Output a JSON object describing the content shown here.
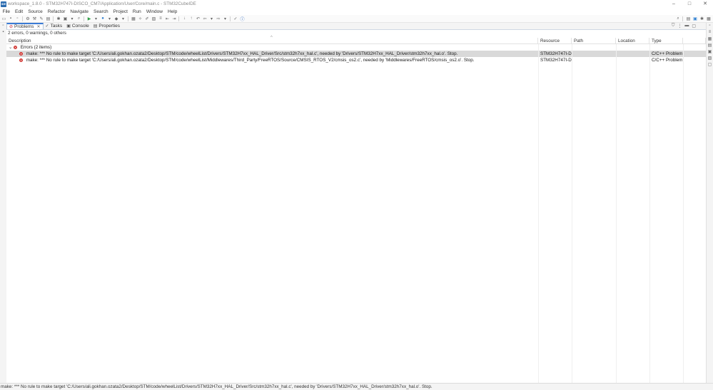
{
  "window": {
    "title": "workspace_1.8.0 - STM32H747I-DISCO_CM7/Application/User/Core/main.c - STM32CubeIDE",
    "controls": [
      "–",
      "□",
      "✕"
    ]
  },
  "menu": [
    "File",
    "Edit",
    "Source",
    "Refactor",
    "Navigate",
    "Search",
    "Project",
    "Run",
    "Window",
    "Help"
  ],
  "tabs": [
    {
      "label": "Problems",
      "active": true,
      "icon": "problems-icon"
    },
    {
      "label": "Tasks",
      "active": false,
      "icon": "tasks-icon"
    },
    {
      "label": "Console",
      "active": false,
      "icon": "console-icon"
    },
    {
      "label": "Properties",
      "active": false,
      "icon": "properties-icon"
    }
  ],
  "problems": {
    "summary": "2 errors, 0 warnings, 0 others",
    "columns": [
      "Description",
      "Resource",
      "Path",
      "Location",
      "Type"
    ],
    "group_label": "Errors (2 items)",
    "rows": [
      {
        "description": "make: *** No rule to make target 'C:/Users/ali.gokhan.ozata2/Desktop/STM/code/wheelList/Drivers/STM32H7xx_HAL_Driver/Src/stm32h7xx_hal.c', needed by 'Drivers/STM32H7xx_HAL_Driver/stm32h7xx_hal.o'.  Stop.",
        "resource": "STM32H747I-D...",
        "path": "",
        "location": "",
        "type": "C/C++ Problem"
      },
      {
        "description": "make: *** No rule to make target 'C:/Users/ali.gokhan.ozata2/Desktop/STM/code/wheelList/Middlewares/Third_Party/FreeRTOS/Source/CMSIS_RTOS_V2/cmsis_os2.c', needed by 'Middlewares/FreeRTOS/cmsis_os2.o'.  Stop.",
        "resource": "STM32H747I-D...",
        "path": "",
        "location": "",
        "type": "C/C++ Problem"
      }
    ]
  },
  "status": {
    "message": "make: *** No rule to make target 'C:/Users/ali.gokhan.ozata2/Desktop/STM/code/wheelList/Drivers/STM32H7xx_HAL_Driver/Src/stm32h7xx_hal.c', needed by 'Drivers/STM32H7xx_HAL_Driver/stm32h7xx_hal.o'.  Stop."
  }
}
